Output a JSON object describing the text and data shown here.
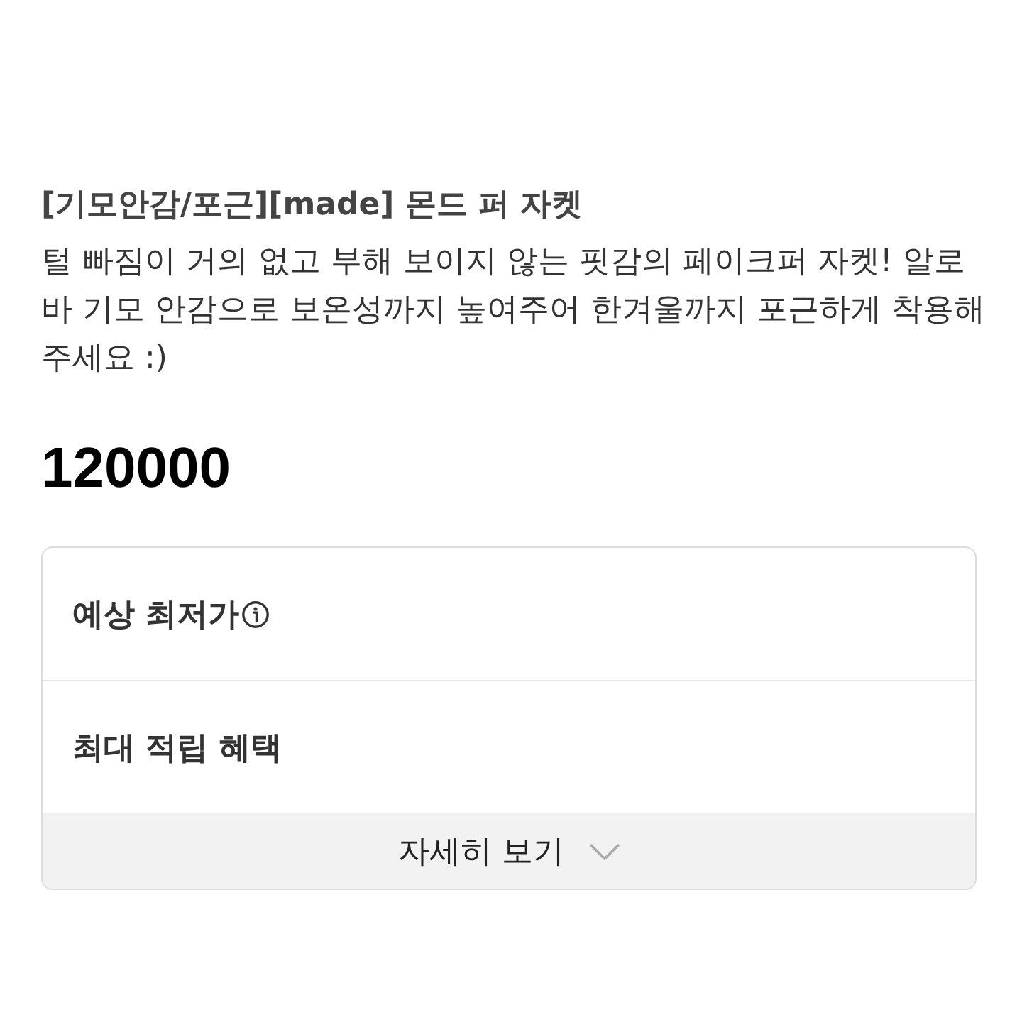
{
  "product": {
    "title": "[기모안감/포근][made] 몬드 퍼 자켓",
    "description": "털 빠짐이 거의 없고 부해 보이지 않는 핏감의 페이크퍼 자켓! 알로바 기모 안감으로 보온성까지 높여주어 한겨울까지 포근하게 착용해 주세요 :)",
    "price": "120000"
  },
  "benefits": {
    "rows": [
      {
        "label": "예상 최저가",
        "kind": "info"
      },
      {
        "label": "최대 적립 혜택",
        "kind": "plain"
      }
    ],
    "more_button": {
      "label": "자세히 보기",
      "expanded": false
    }
  }
}
